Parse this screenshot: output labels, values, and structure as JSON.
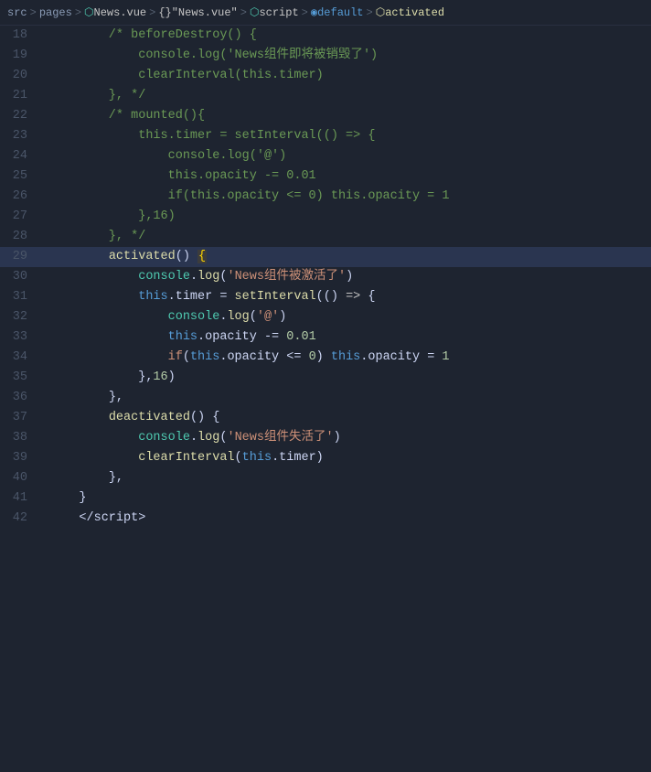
{
  "breadcrumb": {
    "parts": [
      {
        "text": "src",
        "class": "bc-plain"
      },
      {
        "text": ">",
        "class": "bc-sep"
      },
      {
        "text": "pages",
        "class": "bc-plain"
      },
      {
        "text": ">",
        "class": "bc-sep"
      },
      {
        "text": "⬡",
        "class": "bc-icon"
      },
      {
        "text": "News.vue",
        "class": "bc-file"
      },
      {
        "text": ">",
        "class": "bc-sep"
      },
      {
        "text": "{}",
        "class": "bc-curly"
      },
      {
        "text": "\"News.vue\"",
        "class": "bc-file"
      },
      {
        "text": ">",
        "class": "bc-sep"
      },
      {
        "text": "⬡",
        "class": "bc-icon"
      },
      {
        "text": "script",
        "class": "bc-script"
      },
      {
        "text": ">",
        "class": "bc-sep"
      },
      {
        "text": "◉",
        "class": "bc-icon"
      },
      {
        "text": "default",
        "class": "bc-default"
      },
      {
        "text": ">",
        "class": "bc-sep"
      },
      {
        "text": "⬡",
        "class": "bc-icon"
      },
      {
        "text": "activated",
        "class": "bc-activated"
      }
    ]
  },
  "lines": [
    {
      "num": 18,
      "highlighted": false,
      "green_bar": false
    },
    {
      "num": 19,
      "highlighted": false,
      "green_bar": false
    },
    {
      "num": 20,
      "highlighted": false,
      "green_bar": false
    },
    {
      "num": 21,
      "highlighted": false,
      "green_bar": false
    },
    {
      "num": 22,
      "highlighted": false,
      "green_bar": false
    },
    {
      "num": 23,
      "highlighted": false,
      "green_bar": false
    },
    {
      "num": 24,
      "highlighted": false,
      "green_bar": false
    },
    {
      "num": 25,
      "highlighted": false,
      "green_bar": false
    },
    {
      "num": 26,
      "highlighted": false,
      "green_bar": false
    },
    {
      "num": 27,
      "highlighted": false,
      "green_bar": false
    },
    {
      "num": 28,
      "highlighted": false,
      "green_bar": false
    },
    {
      "num": 29,
      "highlighted": true,
      "green_bar": true
    },
    {
      "num": 30,
      "highlighted": false,
      "green_bar": false
    },
    {
      "num": 31,
      "highlighted": false,
      "green_bar": false
    },
    {
      "num": 32,
      "highlighted": false,
      "green_bar": false
    },
    {
      "num": 33,
      "highlighted": false,
      "green_bar": false
    },
    {
      "num": 34,
      "highlighted": false,
      "green_bar": false
    },
    {
      "num": 35,
      "highlighted": false,
      "green_bar": false
    },
    {
      "num": 36,
      "highlighted": false,
      "green_bar": false
    },
    {
      "num": 37,
      "highlighted": false,
      "green_bar": false
    },
    {
      "num": 38,
      "highlighted": false,
      "green_bar": false
    },
    {
      "num": 39,
      "highlighted": false,
      "green_bar": false
    },
    {
      "num": 40,
      "highlighted": false,
      "green_bar": false
    },
    {
      "num": 41,
      "highlighted": false,
      "green_bar": false
    },
    {
      "num": 42,
      "highlighted": false,
      "green_bar": false
    }
  ]
}
